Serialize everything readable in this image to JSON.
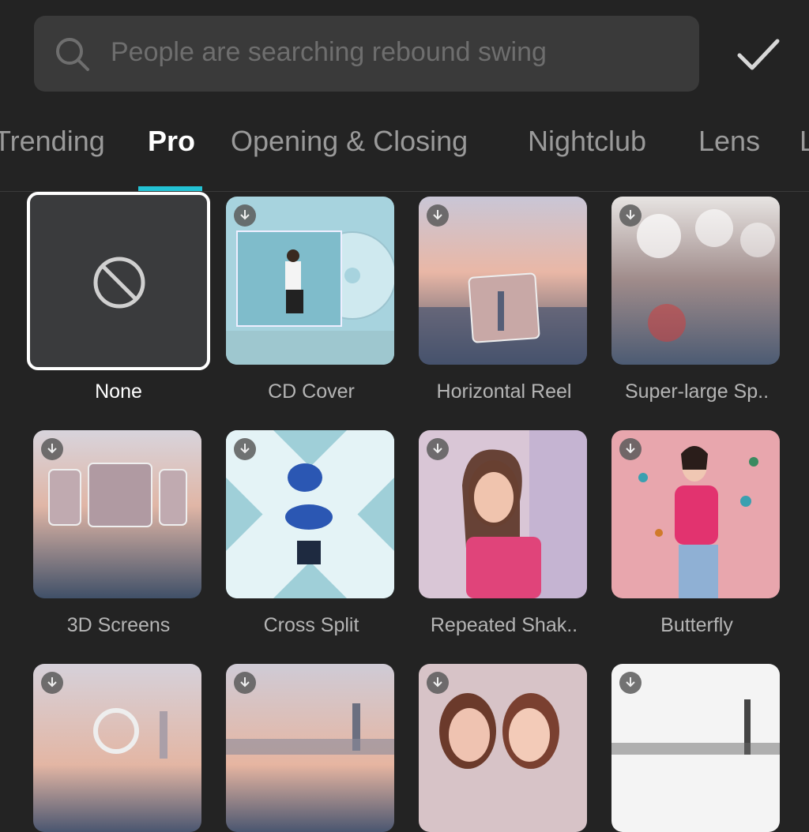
{
  "search": {
    "placeholder": "People are searching rebound swing"
  },
  "tabs": [
    {
      "label": "Trending",
      "active": false
    },
    {
      "label": "Pro",
      "active": true
    },
    {
      "label": "Opening & Closing",
      "active": false
    },
    {
      "label": "Nightclub",
      "active": false
    },
    {
      "label": "Lens",
      "active": false
    },
    {
      "label": "L",
      "active": false
    }
  ],
  "effects": [
    {
      "label": "None",
      "selected": true
    },
    {
      "label": "CD Cover"
    },
    {
      "label": "Horizontal Reel"
    },
    {
      "label": "Super-large Sp.."
    },
    {
      "label": "3D Screens"
    },
    {
      "label": "Cross Split"
    },
    {
      "label": "Repeated Shak.."
    },
    {
      "label": "Butterfly"
    }
  ],
  "colors": {
    "accent": "#23c2d4",
    "background": "#232323",
    "search_bg": "#3a3a3a"
  },
  "icons": {
    "search": "search-icon",
    "confirm": "checkmark-icon",
    "none": "no-effect-icon",
    "download": "download-icon"
  }
}
